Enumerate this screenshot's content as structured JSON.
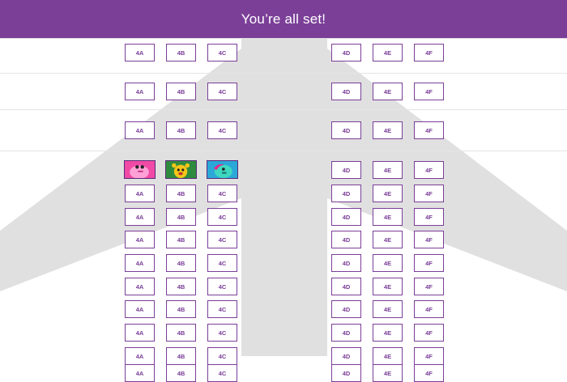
{
  "header": {
    "title": "You’re all set!",
    "bg_color": "#7b3f98"
  },
  "colors": {
    "seat_border": "#7a3e98",
    "plane": "#e0e0e0",
    "row_line": "#e4e4e4"
  },
  "avatars": [
    {
      "seat": "4A",
      "icon": "pink-monster-avatar-icon",
      "bg": "#f04aa6"
    },
    {
      "seat": "4B",
      "icon": "yellow-monster-avatar-icon",
      "bg": "#2e8b3e"
    },
    {
      "seat": "4C",
      "icon": "teal-monster-avatar-icon",
      "bg": "#2ba7d8"
    }
  ],
  "rows": [
    {
      "seats": [
        "4A",
        "4B",
        "4C",
        "4D",
        "4E",
        "4F"
      ]
    },
    {
      "seats": [
        "4A",
        "4B",
        "4C",
        "4D",
        "4E",
        "4F"
      ]
    },
    {
      "seats": [
        "4A",
        "4B",
        "4C",
        "4D",
        "4E",
        "4F"
      ]
    },
    {
      "seats": [
        "4A",
        "4B",
        "4C",
        "4D",
        "4E",
        "4F"
      ]
    },
    {
      "seats": [
        "4A",
        "4B",
        "4C",
        "4D",
        "4E",
        "4F"
      ]
    },
    {
      "seats": [
        "4A",
        "4B",
        "4C",
        "4D",
        "4E",
        "4F"
      ]
    },
    {
      "seats": [
        "4A",
        "4B",
        "4C",
        "4D",
        "4E",
        "4F"
      ]
    },
    {
      "seats": [
        "4A",
        "4B",
        "4C",
        "4D",
        "4E",
        "4F"
      ]
    },
    {
      "seats": [
        "4A",
        "4B",
        "4C",
        "4D",
        "4E",
        "4F"
      ]
    },
    {
      "seats": [
        "4A",
        "4B",
        "4C",
        "4D",
        "4E",
        "4F"
      ]
    },
    {
      "seats": [
        "4A",
        "4B",
        "4C",
        "4D",
        "4E",
        "4F"
      ]
    },
    {
      "seats": [
        "4A",
        "4B",
        "4C",
        "4D",
        "4E",
        "4F"
      ]
    },
    {
      "seats": [
        "4A",
        "4B",
        "4C",
        "4D",
        "4E",
        "4F"
      ]
    }
  ]
}
